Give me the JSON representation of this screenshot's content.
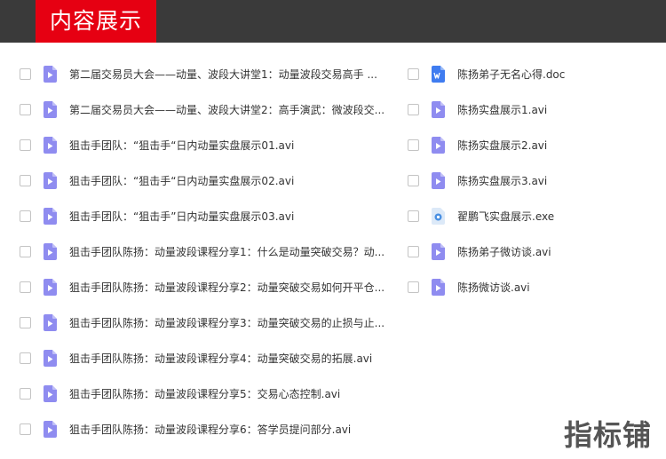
{
  "header": {
    "title": "内容展示"
  },
  "left_files": [
    {
      "name": "第二届交易员大会——动量、波段大讲堂1：动量波段交易高手 ...",
      "icon": "video-file-icon"
    },
    {
      "name": "第二届交易员大会——动量、波段大讲堂2：高手演武：微波段交...",
      "icon": "video-file-icon"
    },
    {
      "name": "狙击手团队：“狙击手“日内动量实盘展示01.avi",
      "icon": "video-file-icon"
    },
    {
      "name": "狙击手团队：“狙击手“日内动量实盘展示02.avi",
      "icon": "video-file-icon"
    },
    {
      "name": "狙击手团队：“狙击手”日内动量实盘展示03.avi",
      "icon": "video-file-icon"
    },
    {
      "name": "狙击手团队陈扬：动量波段课程分享1：什么是动量突破交易？动...",
      "icon": "video-file-icon"
    },
    {
      "name": "狙击手团队陈扬：动量波段课程分享2：动量突破交易如何开平仓...",
      "icon": "video-file-icon"
    },
    {
      "name": "狙击手团队陈扬：动量波段课程分享3：动量突破交易的止损与止...",
      "icon": "video-file-icon"
    },
    {
      "name": "狙击手团队陈扬：动量波段课程分享4：动量突破交易的拓展.avi",
      "icon": "video-file-icon"
    },
    {
      "name": "狙击手团队陈扬：动量波段课程分享5：交易心态控制.avi",
      "icon": "video-file-icon"
    },
    {
      "name": "狙击手团队陈扬：动量波段课程分享6：答学员提问部分.avi",
      "icon": "video-file-icon"
    }
  ],
  "right_files": [
    {
      "name": "陈扬弟子无名心得.doc",
      "icon": "word-file-icon"
    },
    {
      "name": "陈扬实盘展示1.avi",
      "icon": "video-file-icon"
    },
    {
      "name": "陈扬实盘展示2.avi",
      "icon": "video-file-icon"
    },
    {
      "name": "陈扬实盘展示3.avi",
      "icon": "video-file-icon"
    },
    {
      "name": "翟鹏飞实盘展示.exe",
      "icon": "exe-file-icon"
    },
    {
      "name": "陈扬弟子微访谈.avi",
      "icon": "video-file-icon"
    },
    {
      "name": "陈扬微访谈.avi",
      "icon": "video-file-icon"
    }
  ],
  "colors": {
    "header_bg": "#3a3a3a",
    "title_bg": "#e60012",
    "video_icon": "#8f8cf0",
    "word_icon": "#3f7cf0",
    "exe_icon": "#4a90e2"
  },
  "watermark": "指标铺"
}
